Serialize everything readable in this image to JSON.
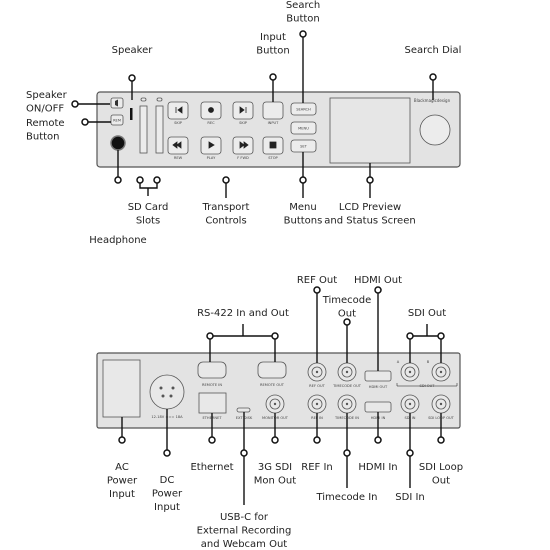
{
  "front_callouts": {
    "search_button": [
      "Search",
      "Button"
    ],
    "speaker": [
      "Speaker"
    ],
    "input_button": [
      "Input",
      "Button"
    ],
    "search_dial": [
      "Search Dial"
    ],
    "speaker_on_off": [
      "Speaker",
      "ON/OFF"
    ],
    "remote_button": [
      "Remote",
      "Button"
    ],
    "headphone": [
      "Headphone"
    ],
    "sd_card_slots": [
      "SD Card",
      "Slots"
    ],
    "transport_controls": [
      "Transport",
      "Controls"
    ],
    "menu_buttons": [
      "Menu",
      "Buttons"
    ],
    "lcd": [
      "LCD Preview",
      "and Status Screen"
    ]
  },
  "front_panel": {
    "brand": "Blackmagicdesign",
    "remote": "REM",
    "buttons": [
      "SKIP",
      "REC",
      "SKIP",
      "INPUT",
      "REW",
      "PLAY",
      "F FWD",
      "STOP"
    ],
    "menu": [
      "SEARCH",
      "MENU",
      "SET"
    ]
  },
  "rear_callouts": {
    "rs422": [
      "RS-422 In and Out"
    ],
    "ref_out": [
      "REF Out"
    ],
    "timecode_out": [
      "Timecode",
      "Out"
    ],
    "hdmi_out": [
      "HDMI Out"
    ],
    "sdi_out": [
      "SDI Out"
    ],
    "ac_power": [
      "AC",
      "Power",
      "Input"
    ],
    "dc_power": [
      "DC",
      "Power",
      "Input"
    ],
    "ethernet": [
      "Ethernet"
    ],
    "usbc": [
      "USB-C for",
      "External Recording",
      "and Webcam Out"
    ],
    "mon_out": [
      "3G SDI",
      "Mon Out"
    ],
    "ref_in": [
      "REF In"
    ],
    "timecode_in": [
      "Timecode In"
    ],
    "hdmi_in": [
      "HDMI In"
    ],
    "sdi_in": [
      "SDI In"
    ],
    "sdi_loop": [
      "SDI Loop",
      "Out"
    ]
  },
  "rear_panel": {
    "power": "12-18V === 18A",
    "remote_in": "REMOTE IN",
    "remote_out": "REMOTE OUT",
    "ethernet": "ETHERNET",
    "ext_disk": "EXT DISK",
    "monitor_out": "MONITOR OUT",
    "ref_out": "REF OUT",
    "timecode_out": "TIMECODE OUT",
    "hdmi_out": "HDMI OUT",
    "sdi_out": "SDI OUT",
    "ref_in": "REF IN",
    "timecode_in": "TIMECODE IN",
    "hdmi_in": "HDMI IN",
    "sdi_in": "SDI IN",
    "sdi_loop_out": "SDI LOOP OUT",
    "a": "A",
    "b": "B"
  }
}
